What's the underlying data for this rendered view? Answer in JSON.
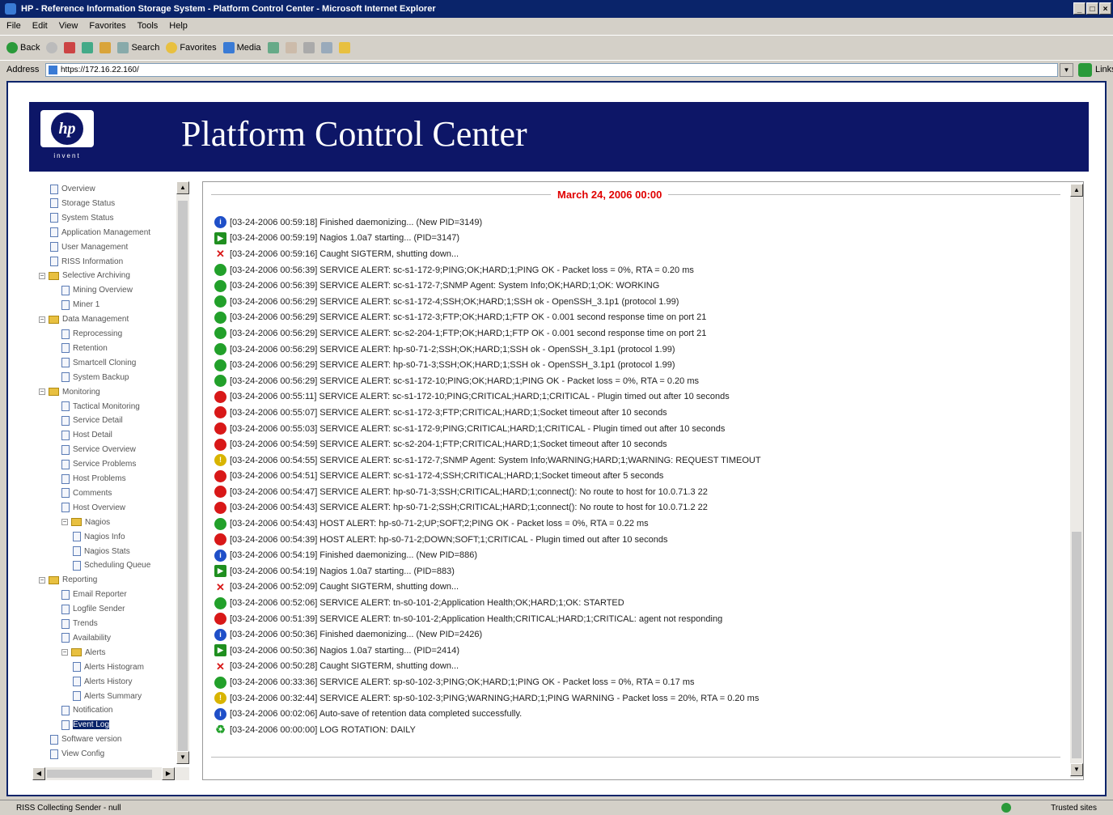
{
  "window": {
    "title": "HP - Reference Information Storage System - Platform Control Center - Microsoft Internet Explorer"
  },
  "menu": [
    "File",
    "Edit",
    "View",
    "Favorites",
    "Tools",
    "Help"
  ],
  "toolbar": {
    "back": "Back",
    "search": "Search",
    "favorites": "Favorites",
    "media": "Media"
  },
  "address": {
    "label": "Address",
    "url": "https://172.16.22.160/",
    "links": "Links"
  },
  "banner": {
    "logo_text": "hp",
    "logo_tagline": "invent",
    "title": "Platform Control Center"
  },
  "nav": [
    {
      "label": "Overview",
      "kind": "doc",
      "level": 1
    },
    {
      "label": "Storage Status",
      "kind": "doc",
      "level": 1
    },
    {
      "label": "System Status",
      "kind": "doc",
      "level": 1
    },
    {
      "label": "Application Management",
      "kind": "doc",
      "level": 1
    },
    {
      "label": "User Management",
      "kind": "doc",
      "level": 1
    },
    {
      "label": "RISS Information",
      "kind": "doc",
      "level": 1
    },
    {
      "label": "Selective Archiving",
      "kind": "folder",
      "level": 0
    },
    {
      "label": "Mining Overview",
      "kind": "doc",
      "level": 2
    },
    {
      "label": "Miner 1",
      "kind": "doc",
      "level": 2
    },
    {
      "label": "Data Management",
      "kind": "folder",
      "level": 0
    },
    {
      "label": "Reprocessing",
      "kind": "doc",
      "level": 2
    },
    {
      "label": "Retention",
      "kind": "doc",
      "level": 2
    },
    {
      "label": "Smartcell Cloning",
      "kind": "doc",
      "level": 2
    },
    {
      "label": "System Backup",
      "kind": "doc",
      "level": 2
    },
    {
      "label": "Monitoring",
      "kind": "folder",
      "level": 0
    },
    {
      "label": "Tactical Monitoring",
      "kind": "doc",
      "level": 2
    },
    {
      "label": "Service Detail",
      "kind": "doc",
      "level": 2
    },
    {
      "label": "Host Detail",
      "kind": "doc",
      "level": 2
    },
    {
      "label": "Service Overview",
      "kind": "doc",
      "level": 2
    },
    {
      "label": "Service Problems",
      "kind": "doc",
      "level": 2
    },
    {
      "label": "Host Problems",
      "kind": "doc",
      "level": 2
    },
    {
      "label": "Comments",
      "kind": "doc",
      "level": 2
    },
    {
      "label": "Host Overview",
      "kind": "doc",
      "level": 2
    },
    {
      "label": "Nagios",
      "kind": "folder",
      "level": 2
    },
    {
      "label": "Nagios Info",
      "kind": "doc",
      "level": 3
    },
    {
      "label": "Nagios Stats",
      "kind": "doc",
      "level": 3
    },
    {
      "label": "Scheduling Queue",
      "kind": "doc",
      "level": 3
    },
    {
      "label": "Reporting",
      "kind": "folder",
      "level": 0
    },
    {
      "label": "Email Reporter",
      "kind": "doc",
      "level": 2
    },
    {
      "label": "Logfile Sender",
      "kind": "doc",
      "level": 2
    },
    {
      "label": "Trends",
      "kind": "doc",
      "level": 2
    },
    {
      "label": "Availability",
      "kind": "doc",
      "level": 2
    },
    {
      "label": "Alerts",
      "kind": "folder",
      "level": 2
    },
    {
      "label": "Alerts Histogram",
      "kind": "doc",
      "level": 3
    },
    {
      "label": "Alerts History",
      "kind": "doc",
      "level": 3
    },
    {
      "label": "Alerts Summary",
      "kind": "doc",
      "level": 3
    },
    {
      "label": "Notification",
      "kind": "doc",
      "level": 2
    },
    {
      "label": "Event Log",
      "kind": "doc",
      "level": 2
    },
    {
      "label": "Software version",
      "kind": "doc",
      "level": 1
    },
    {
      "label": "View Config",
      "kind": "doc",
      "level": 1
    }
  ],
  "log": {
    "date": "March 24, 2006 00:00",
    "entries": [
      {
        "icon": "info",
        "text": "[03-24-2006 00:59:18] Finished daemonizing... (New PID=3149)"
      },
      {
        "icon": "nagios",
        "text": "[03-24-2006 00:59:19] Nagios 1.0a7 starting... (PID=3147)"
      },
      {
        "icon": "stop",
        "text": "[03-24-2006 00:59:16] Caught SIGTERM, shutting down..."
      },
      {
        "icon": "ok",
        "text": "[03-24-2006 00:56:39] SERVICE ALERT: sc-s1-172-9;PING;OK;HARD;1;PING OK - Packet loss = 0%, RTA = 0.20 ms"
      },
      {
        "icon": "ok",
        "text": "[03-24-2006 00:56:39] SERVICE ALERT: sc-s1-172-7;SNMP Agent: System Info;OK;HARD;1;OK: WORKING"
      },
      {
        "icon": "ok",
        "text": "[03-24-2006 00:56:29] SERVICE ALERT: sc-s1-172-4;SSH;OK;HARD;1;SSH ok - OpenSSH_3.1p1 (protocol 1.99)"
      },
      {
        "icon": "ok",
        "text": "[03-24-2006 00:56:29] SERVICE ALERT: sc-s1-172-3;FTP;OK;HARD;1;FTP OK - 0.001 second response time on port 21"
      },
      {
        "icon": "ok",
        "text": "[03-24-2006 00:56:29] SERVICE ALERT: sc-s2-204-1;FTP;OK;HARD;1;FTP OK - 0.001 second response time on port 21"
      },
      {
        "icon": "ok",
        "text": "[03-24-2006 00:56:29] SERVICE ALERT: hp-s0-71-2;SSH;OK;HARD;1;SSH ok - OpenSSH_3.1p1 (protocol 1.99)"
      },
      {
        "icon": "ok",
        "text": "[03-24-2006 00:56:29] SERVICE ALERT: hp-s0-71-3;SSH;OK;HARD;1;SSH ok - OpenSSH_3.1p1 (protocol 1.99)"
      },
      {
        "icon": "ok",
        "text": "[03-24-2006 00:56:29] SERVICE ALERT: sc-s1-172-10;PING;OK;HARD;1;PING OK - Packet loss = 0%, RTA = 0.20 ms"
      },
      {
        "icon": "critical",
        "text": "[03-24-2006 00:55:11] SERVICE ALERT: sc-s1-172-10;PING;CRITICAL;HARD;1;CRITICAL - Plugin timed out after 10 seconds"
      },
      {
        "icon": "critical",
        "text": "[03-24-2006 00:55:07] SERVICE ALERT: sc-s1-172-3;FTP;CRITICAL;HARD;1;Socket timeout after 10 seconds"
      },
      {
        "icon": "critical",
        "text": "[03-24-2006 00:55:03] SERVICE ALERT: sc-s1-172-9;PING;CRITICAL;HARD;1;CRITICAL - Plugin timed out after 10 seconds"
      },
      {
        "icon": "critical",
        "text": "[03-24-2006 00:54:59] SERVICE ALERT: sc-s2-204-1;FTP;CRITICAL;HARD;1;Socket timeout after 10 seconds"
      },
      {
        "icon": "warning",
        "text": "[03-24-2006 00:54:55] SERVICE ALERT: sc-s1-172-7;SNMP Agent: System Info;WARNING;HARD;1;WARNING: REQUEST TIMEOUT"
      },
      {
        "icon": "critical",
        "text": "[03-24-2006 00:54:51] SERVICE ALERT: sc-s1-172-4;SSH;CRITICAL;HARD;1;Socket timeout after 5 seconds"
      },
      {
        "icon": "critical",
        "text": "[03-24-2006 00:54:47] SERVICE ALERT: hp-s0-71-3;SSH;CRITICAL;HARD;1;connect(): No route to host for 10.0.71.3 22"
      },
      {
        "icon": "critical",
        "text": "[03-24-2006 00:54:43] SERVICE ALERT: hp-s0-71-2;SSH;CRITICAL;HARD;1;connect(): No route to host for 10.0.71.2 22"
      },
      {
        "icon": "ok",
        "text": "[03-24-2006 00:54:43] HOST ALERT: hp-s0-71-2;UP;SOFT;2;PING OK - Packet loss = 0%, RTA = 0.22 ms"
      },
      {
        "icon": "critical",
        "text": "[03-24-2006 00:54:39] HOST ALERT: hp-s0-71-2;DOWN;SOFT;1;CRITICAL - Plugin timed out after 10 seconds"
      },
      {
        "icon": "info",
        "text": "[03-24-2006 00:54:19] Finished daemonizing... (New PID=886)"
      },
      {
        "icon": "nagios",
        "text": "[03-24-2006 00:54:19] Nagios 1.0a7 starting... (PID=883)"
      },
      {
        "icon": "stop",
        "text": "[03-24-2006 00:52:09] Caught SIGTERM, shutting down..."
      },
      {
        "icon": "ok",
        "text": "[03-24-2006 00:52:06] SERVICE ALERT: tn-s0-101-2;Application Health;OK;HARD;1;OK: STARTED"
      },
      {
        "icon": "critical",
        "text": "[03-24-2006 00:51:39] SERVICE ALERT: tn-s0-101-2;Application Health;CRITICAL;HARD;1;CRITICAL: agent not responding"
      },
      {
        "icon": "info",
        "text": "[03-24-2006 00:50:36] Finished daemonizing... (New PID=2426)"
      },
      {
        "icon": "nagios",
        "text": "[03-24-2006 00:50:36] Nagios 1.0a7 starting... (PID=2414)"
      },
      {
        "icon": "stop",
        "text": "[03-24-2006 00:50:28] Caught SIGTERM, shutting down..."
      },
      {
        "icon": "ok",
        "text": "[03-24-2006 00:33:36] SERVICE ALERT: sp-s0-102-3;PING;OK;HARD;1;PING OK - Packet loss = 0%, RTA = 0.17 ms"
      },
      {
        "icon": "warning",
        "text": "[03-24-2006 00:32:44] SERVICE ALERT: sp-s0-102-3;PING;WARNING;HARD;1;PING WARNING - Packet loss = 20%, RTA = 0.20 ms"
      },
      {
        "icon": "info",
        "text": "[03-24-2006 00:02:06] Auto-save of retention data completed successfully."
      },
      {
        "icon": "rotation",
        "text": "[03-24-2006 00:00:00] LOG ROTATION: DAILY"
      }
    ]
  },
  "status": {
    "text": "RISS Collecting Sender - null",
    "zone": "Trusted sites"
  },
  "colors": {
    "banner": "#0d1667",
    "date": "#e00000",
    "ok": "#22a02a",
    "critical": "#d81818",
    "warning": "#d8b400",
    "info": "#1f4fc8"
  }
}
